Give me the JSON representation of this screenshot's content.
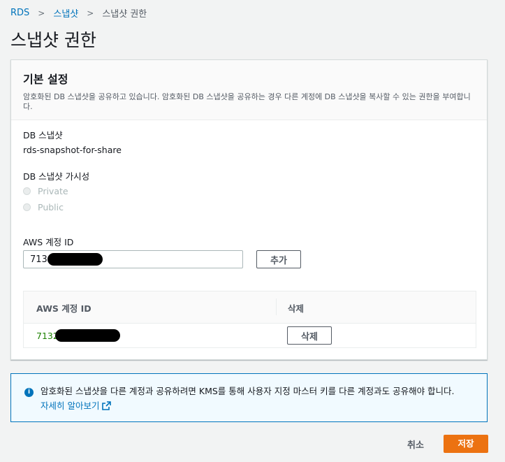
{
  "breadcrumb": {
    "root": "RDS",
    "parent": "스냅샷",
    "current": "스냅샷 권한"
  },
  "page_title": "스냅샷 권한",
  "panel": {
    "title": "기본 설정",
    "description": "암호화된 DB 스냅샷을 공유하고 있습니다. 암호화된 DB 스냅샷을 공유하는 경우 다른 계정에 DB 스냅샷을 복사할 수 있는 권한을 부여합니다.",
    "snapshot_label": "DB 스냅샷",
    "snapshot_value": "rds-snapshot-for-share",
    "visibility_label": "DB 스냅샷 가시성",
    "visibility_options": [
      "Private",
      "Public"
    ],
    "account_label": "AWS 계정 ID",
    "account_input_value": "713",
    "add_button": "추가",
    "table": {
      "headers": [
        "AWS 계정 ID",
        "삭제"
      ],
      "rows": [
        {
          "account_id": "7132",
          "delete_label": "삭제"
        }
      ]
    }
  },
  "info": {
    "text": "암호화된 스냅샷을 다른 계정과 공유하려면 KMS를 통해 사용자 지정 마스터 키를 다른 계정과도 공유해야 합니다.",
    "link": "자세히 알아보기"
  },
  "footer": {
    "cancel": "취소",
    "save": "저장"
  },
  "colors": {
    "accent": "#ec7211",
    "link": "#0073bb",
    "success": "#1d8102"
  },
  "icons": [
    "chevron-right-icon",
    "info-icon",
    "external-link-icon"
  ]
}
